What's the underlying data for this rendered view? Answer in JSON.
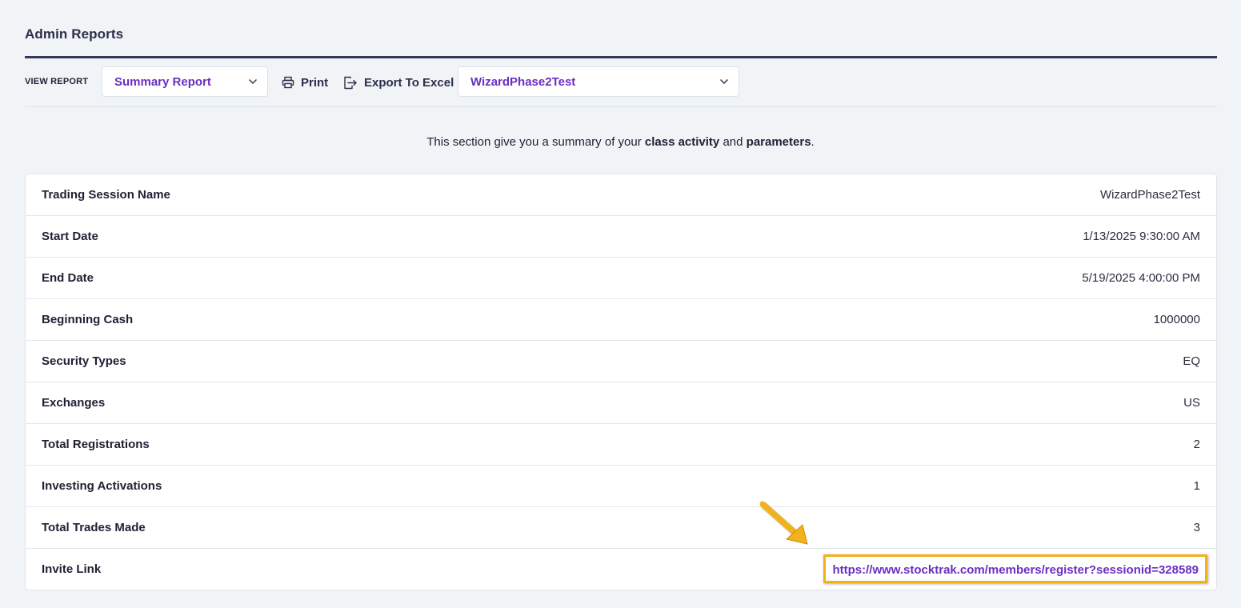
{
  "page_title": "Admin Reports",
  "toolbar": {
    "view_report_label": "VIEW REPORT",
    "report_select_value": "Summary Report",
    "print_label": "Print",
    "export_label": "Export To Excel",
    "session_select_value": "WizardPhase2Test"
  },
  "intro": {
    "prefix": "This section give you a summary of your ",
    "bold1": "class activity",
    "middle": " and ",
    "bold2": "parameters",
    "suffix": "."
  },
  "summary": {
    "rows": [
      {
        "label": "Trading Session Name",
        "value": "WizardPhase2Test"
      },
      {
        "label": "Start Date",
        "value": "1/13/2025 9:30:00 AM"
      },
      {
        "label": "End Date",
        "value": "5/19/2025 4:00:00 PM"
      },
      {
        "label": "Beginning Cash",
        "value": "1000000"
      },
      {
        "label": "Security Types",
        "value": "EQ"
      },
      {
        "label": "Exchanges",
        "value": "US"
      },
      {
        "label": "Total Registrations",
        "value": "2"
      },
      {
        "label": "Investing Activations",
        "value": "1"
      },
      {
        "label": "Total Trades Made",
        "value": "3"
      },
      {
        "label": "Invite Link",
        "value": "https://www.stocktrak.com/members/register?sessionid=328589"
      }
    ]
  },
  "colors": {
    "accent_purple": "#6a2fc2",
    "highlight_yellow": "#f2b21c",
    "header_rule": "#36385a",
    "background": "#f0f4f7"
  },
  "icons": {
    "print": "printer-icon",
    "export": "export-icon",
    "dropdown": "chevron-down-icon",
    "annotation": "arrow-annotation-icon"
  }
}
